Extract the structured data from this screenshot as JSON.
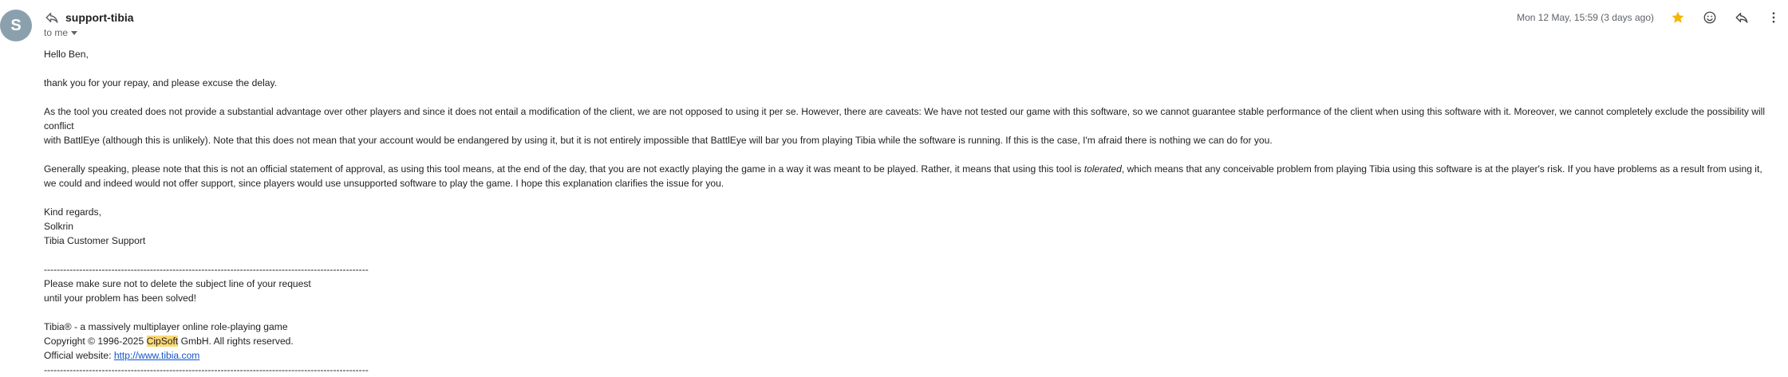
{
  "header": {
    "avatar_letter": "S",
    "sender": "support-tibia",
    "to_label": "to me",
    "date": "Mon 12 May, 15:59 (3 days ago)"
  },
  "icons": {
    "reply_small": "reply-icon",
    "star": "star-icon",
    "emoji": "emoji-icon",
    "reply": "reply-icon",
    "more": "more-vert-icon",
    "star_color": "#f4b400"
  },
  "body": {
    "greeting": "Hello Ben,",
    "p1": "thank you for your repay, and please excuse the delay.",
    "p2_line1": "As the tool you created does not provide a substantial advantage over other players and since it does not entail a modification of the client, we are not opposed to using it per se. However, there are caveats: We have not tested our game with this software, so we cannot guarantee stable performance of the client when using this software with it. Moreover, we cannot completely exclude the possibility will conflict",
    "p2_line2": "with BattlEye (although this is unlikely). Note that this does not mean that your account would be endangered by using it,  but it is not entirely impossible that BattlEye will bar you from playing Tibia while the software is running. If this is the case, I'm afraid there is nothing we can do for you.",
    "p3_line1_a": "Generally speaking, please note that this is not an official statement of approval, as using this tool means, at the end of the day, that you are not exactly playing the game in a way it was meant to be played. Rather, it means that using this tool is ",
    "p3_line1_em": "tolerated",
    "p3_line1_b": ", which means that any conceivable problem from playing Tibia using this software is at the player's risk. If you have problems as a result from using it,",
    "p3_line2": "we could and indeed would not offer support, since players would use unsupported software to play the game. I hope this explanation clarifies the issue for you.",
    "closing": "Kind regards,",
    "name": "Solkrin",
    "team": "Tibia Customer Support",
    "divider": "-----------------------------------------------------------------------------------------------------",
    "note1": "Please make sure not to delete the subject line of your request",
    "note2": "until your problem has been solved!",
    "tagline": "Tibia® - a massively multiplayer online role-playing game",
    "copyright_a": "Copyright © 1996-2025 ",
    "copyright_hl": "CipSoft",
    "copyright_b": " GmbH. All rights reserved.",
    "website_label": "Official website: ",
    "website_url": "http://www.tibia.com"
  }
}
